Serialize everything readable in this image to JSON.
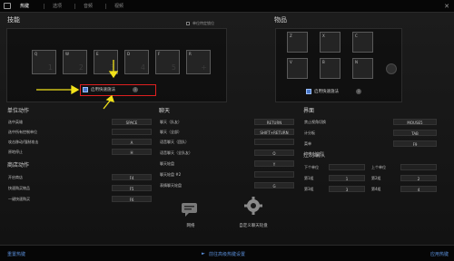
{
  "tabs": [
    {
      "label": "热键",
      "active": true
    },
    {
      "label": "选项",
      "active": false
    },
    {
      "label": "音频",
      "active": false
    },
    {
      "label": "视频",
      "active": false
    }
  ],
  "close_glyph": "✕",
  "skills": {
    "title": "技能",
    "unit_hotkey_checkbox": "单位特定锁位",
    "keys": [
      {
        "key": "Q",
        "num": "1"
      },
      {
        "key": "W",
        "num": "2"
      },
      {
        "key": "E",
        "num": "3"
      },
      {
        "key": "D",
        "num": "4"
      },
      {
        "key": "F",
        "num": "5"
      },
      {
        "key": "R",
        "num": "+"
      }
    ],
    "quick_cast_label": "启用快速施法"
  },
  "items": {
    "title": "物品",
    "keys": [
      "Z",
      "X",
      "C",
      "V",
      "B",
      "N"
    ],
    "quick_cast_label": "启用快速施法"
  },
  "unit_actions": {
    "title": "单位动作",
    "rows": [
      {
        "label": "选中英雄",
        "key": "SPACE"
      },
      {
        "label": "选中所有控制单位",
        "key": ""
      },
      {
        "label": "攻击移动/强制攻击",
        "key": "A"
      },
      {
        "label": "原地停止",
        "key": "H"
      }
    ]
  },
  "shop_actions": {
    "title": "商店动作",
    "rows": [
      {
        "label": "开启商店",
        "key": "F4"
      },
      {
        "label": "快速购买物品",
        "key": "F5"
      },
      {
        "label": "一键快速购买",
        "key": "F6"
      }
    ]
  },
  "chat": {
    "title": "聊天",
    "rows": [
      {
        "label": "聊天（队友）",
        "key": "RETURN"
      },
      {
        "label": "聊天（全部）",
        "key": "SHIFT+RETURN"
      },
      {
        "label": "语音聊天（团队）",
        "key": ""
      },
      {
        "label": "语音聊天（全队友）",
        "key": "Q"
      },
      {
        "label": "聊天轮盘",
        "key": "Y"
      },
      {
        "label": "聊天轮盘 #2",
        "key": ""
      },
      {
        "label": "表情聊天轮盘",
        "key": "G"
      }
    ]
  },
  "interface": {
    "title": "界面",
    "rows": [
      {
        "label": "禁止视角切换",
        "key": "MOUSE5"
      },
      {
        "label": "计分板",
        "key": "TAB"
      },
      {
        "label": "菜单",
        "key": "F9"
      }
    ]
  },
  "control_groups": {
    "title": "控制编队",
    "rows": [
      {
        "l1": "下个单位",
        "k1": "",
        "l2": "上个单位",
        "k2": ""
      },
      {
        "l1": "第1组",
        "k1": "1",
        "l2": "第2组",
        "k2": "2"
      },
      {
        "l1": "第3组",
        "k1": "3",
        "l2": "第4组",
        "k2": "4"
      }
    ]
  },
  "bottom_buttons": {
    "chat_wheel": "网络",
    "custom_chat": "自定义聊天轮盘"
  },
  "footer": {
    "reset": "重置热键",
    "advanced": "前往高级热键设置",
    "apply": "应用热键"
  },
  "colors": {
    "accent_link": "#5a8ed8",
    "highlight": "#e02020",
    "arrow": "#f2e21a"
  }
}
